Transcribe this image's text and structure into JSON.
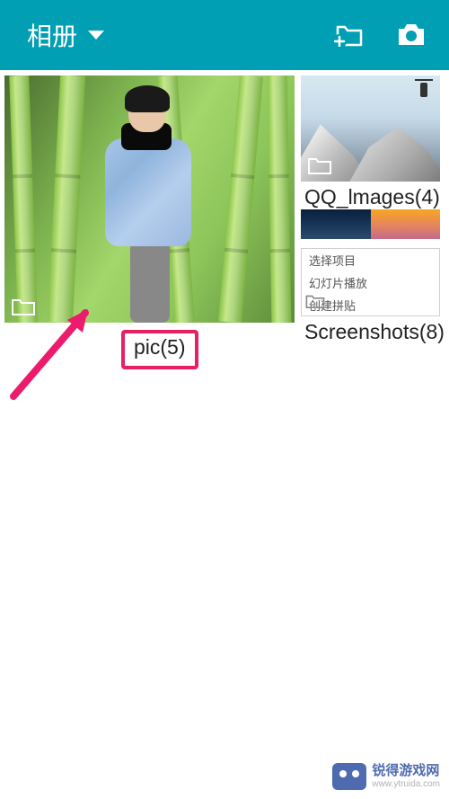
{
  "header": {
    "title": "相册"
  },
  "albums": {
    "main": {
      "label": "pic(5)"
    },
    "qq_images": {
      "label": "QQ_lmages(4)"
    },
    "screenshots": {
      "label": "Screenshots(8)",
      "menu": {
        "item1": "选择项目",
        "item2": "幻灯片播放",
        "item3": "创建拼贴"
      }
    }
  },
  "watermark": {
    "line1": "锐得游戏网",
    "line2": "www.ytruida.com"
  },
  "colors": {
    "header_bg": "#009fb3",
    "highlight_border": "#e91e63",
    "arrow": "#ec1b6b"
  }
}
